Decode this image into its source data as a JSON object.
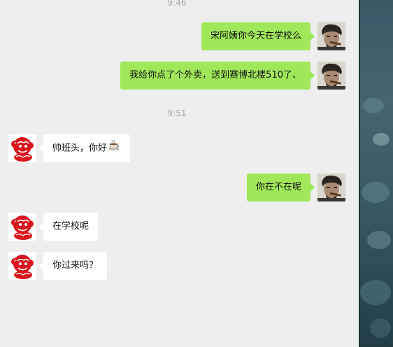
{
  "chat": {
    "messages": [
      {
        "type": "time",
        "text": "9:46"
      },
      {
        "type": "message",
        "side": "me",
        "text": "宋阿姨你今天在学校么",
        "avatar": "man-with-cigar-avatar"
      },
      {
        "type": "message",
        "side": "me",
        "text": "我给你点了个外卖，送到赛博北楼510了、",
        "avatar": "man-with-cigar-avatar"
      },
      {
        "type": "time",
        "text": "9:51"
      },
      {
        "type": "message",
        "side": "them",
        "text": "帅班头，你好",
        "emoji": "coffee-cup-icon",
        "avatar": "red-monkey-papercut-avatar"
      },
      {
        "type": "message",
        "side": "me",
        "text": "你在不在呢",
        "avatar": "man-with-cigar-avatar"
      },
      {
        "type": "message",
        "side": "them",
        "text": "在学校呢",
        "avatar": "red-monkey-papercut-avatar"
      },
      {
        "type": "message",
        "side": "them",
        "text": "你过来吗？",
        "avatar": "red-monkey-papercut-avatar"
      }
    ]
  },
  "colors": {
    "sent_bubble": "#a0e75a",
    "received_bubble": "#ffffff",
    "chat_background": "#eeeeee",
    "timestamp": "#a8a8a8"
  }
}
